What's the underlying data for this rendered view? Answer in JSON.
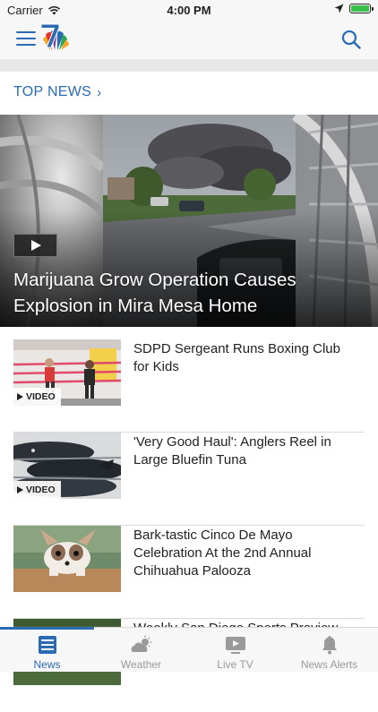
{
  "status_bar": {
    "carrier": "Carrier",
    "time": "4:00 PM"
  },
  "nav": {
    "brand_logo": "nbc-7-logo",
    "menu_icon": "hamburger-menu-icon",
    "search_icon": "search-icon"
  },
  "section": {
    "title": "TOP NEWS",
    "chevron": "›"
  },
  "hero": {
    "title": "Marijuana Grow Operation Causes Explosion in Mira Mesa Home",
    "has_video": true
  },
  "stories": [
    {
      "headline": "SDPD Sergeant Runs Boxing Club for Kids",
      "badge": "VIDEO"
    },
    {
      "headline": "'Very Good Haul': Anglers Reel in Large Bluefin Tuna",
      "badge": "VIDEO"
    },
    {
      "headline": "Bark-tastic Cinco De Mayo Celebration At the 2nd Annual Chihuahua Palooza",
      "badge": ""
    },
    {
      "headline": "Weekly San Diego Sports Preview",
      "badge": ""
    }
  ],
  "tabs": [
    {
      "label": "News",
      "icon": "news-icon",
      "active": true
    },
    {
      "label": "Weather",
      "icon": "weather-icon",
      "active": false
    },
    {
      "label": "Live TV",
      "icon": "live-tv-icon",
      "active": false
    },
    {
      "label": "News Alerts",
      "icon": "bell-icon",
      "active": false
    }
  ],
  "colors": {
    "accent": "#2a6bb3",
    "inactive_tab": "#9a9a9a",
    "battery": "#3cc04d"
  }
}
